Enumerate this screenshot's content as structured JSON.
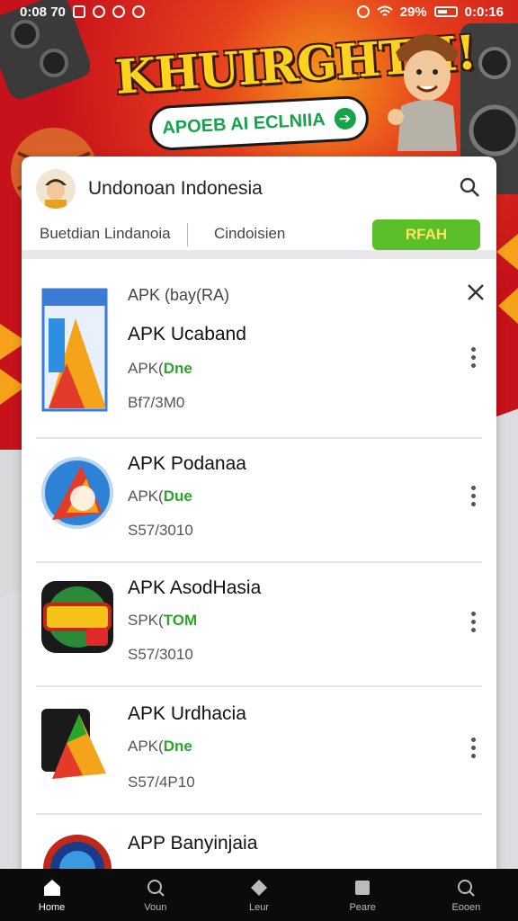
{
  "status_bar": {
    "time_left": "0:08 70",
    "battery": "29%",
    "time_right": "0:0:16"
  },
  "banner": {
    "title": "KHUIRGHTH!",
    "pill_label": "APOEB AI ECLNIIA"
  },
  "header": {
    "title": "Undonoan Indonesia",
    "tabs": [
      "Buetdian Lindanoia",
      "Cindoisien"
    ],
    "action_button": "RFAH"
  },
  "items": [
    {
      "tag": "APK (bay(RA)",
      "name": "APK Ucaband",
      "sub_prefix": "APK(",
      "sub_version": "Dne",
      "size": "Bf7/3M0"
    },
    {
      "name": "APK Podanaa",
      "sub_prefix": "APK(",
      "sub_version": "Due",
      "size": "S57/3010"
    },
    {
      "name": "APK AsodHasia",
      "sub_prefix": "SPK(",
      "sub_version": "TOM",
      "size": "S57/3010"
    },
    {
      "name": "APK Urdhacia",
      "sub_prefix": "APK(",
      "sub_version": "Dne",
      "size": "S57/4P10"
    },
    {
      "name": "APP Banyinjaia"
    }
  ],
  "bottom_nav": [
    {
      "label": "Home",
      "icon": "home-icon"
    },
    {
      "label": "Voun",
      "icon": "search-icon"
    },
    {
      "label": "Leur",
      "icon": "diamond-icon"
    },
    {
      "label": "Peare",
      "icon": "square-icon"
    },
    {
      "label": "Eooen",
      "icon": "search-icon"
    }
  ],
  "colors": {
    "brand_red": "#c8121b",
    "accent_green": "#5bbf2a",
    "version_green": "#2aa52a",
    "banner_yellow": "#ffd21f"
  }
}
